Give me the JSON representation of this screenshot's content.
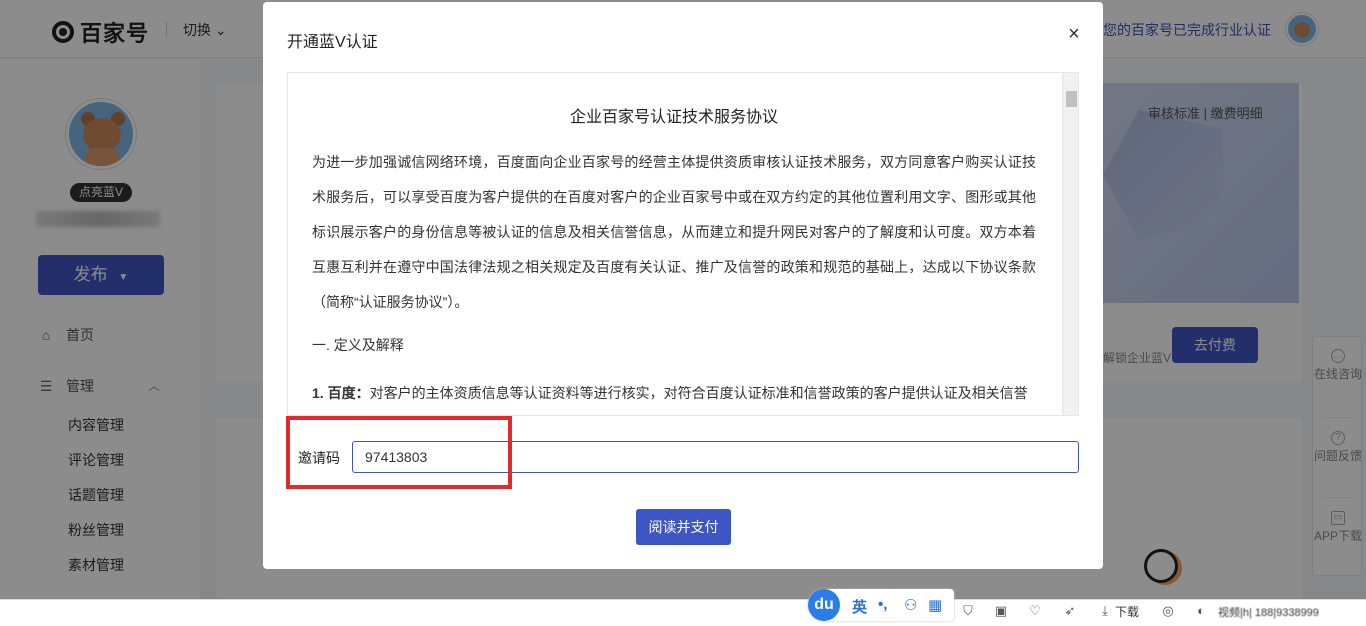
{
  "header": {
    "logo_text": "百家号",
    "switch_label": "切换",
    "notice": "您的百家号已完成行业认证"
  },
  "sidebar": {
    "badge": "点亮蓝V",
    "publish": "发布",
    "nav": {
      "home": "首页",
      "manage": "管理",
      "items": [
        "内容管理",
        "评论管理",
        "话题管理",
        "粉丝管理",
        "素材管理"
      ]
    }
  },
  "background": {
    "banner_links": "审核标准  |  缴费明细",
    "go_pay": "去付费",
    "unlock_text": "解锁企业蓝V",
    "float": {
      "consult": "在线咨询",
      "feedback": "问题反馈",
      "app": "APP下载"
    }
  },
  "modal": {
    "title": "开通蓝V认证",
    "close": "×",
    "agreement": {
      "heading": "企业百家号认证技术服务协议",
      "paragraph": "为进一步加强诚信网络环境，百度面向企业百家号的经营主体提供资质审核认证技术服务，双方同意客户购买认证技术服务后，可以享受百度为客户提供的在百度对客户的企业百家号中或在双方约定的其他位置利用文字、图形或其他标识展示客户的身份信息等被认证的信息及相关信誉信息，从而建立和提升网民对客户的了解度和认可度。双方本着互惠互利并在遵守中国法律法规之相关规定及百度有关认证、推广及信誉的政策和规范的基础上，达成以下协议条款（简称“认证服务协议”）。",
      "section": "一. 定义及解释",
      "clause_bold": "1. 百度：",
      "clause_text": "对客户的主体资质信息等认证资料等进行核实，对符合百度认证标准和信誉政策的客户提供认证及相关信誉"
    },
    "invite": {
      "label": "邀请码",
      "value": "97413803"
    },
    "submit": "阅读并支付"
  },
  "taskbar": {
    "ime_du": "du",
    "ime_lang": "英",
    "ime_punct": "•,",
    "download": "下载",
    "blurry": "视频|h| 188|9338999"
  }
}
